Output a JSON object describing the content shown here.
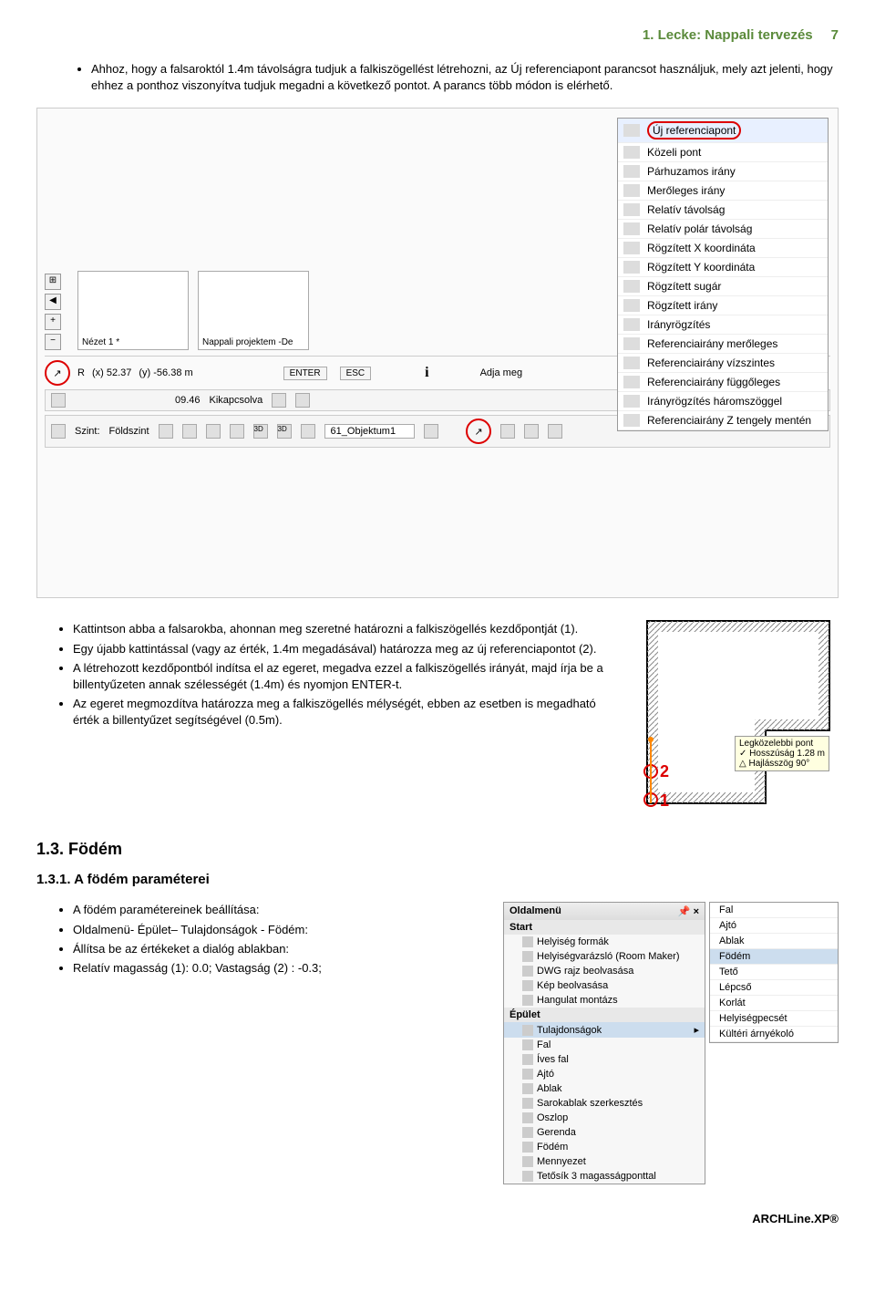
{
  "header": {
    "title": "1. Lecke: Nappali tervezés",
    "page": "7"
  },
  "intro": [
    "Ahhoz, hogy a falsaroktól 1.4m távolságra tudjuk a falkiszögellést létrehozni, az Új referenciapont parancsot használjuk, mely azt jelenti, hogy ehhez a ponthoz viszonyítva tudjuk megadni a következő pontot. A parancs több módon is elérhető."
  ],
  "ctx_items": [
    "Új referenciapont",
    "Közeli pont",
    "Párhuzamos irány",
    "Merőleges irány",
    "Relatív távolság",
    "Relatív polár távolság",
    "Rögzített X koordináta",
    "Rögzített Y koordináta",
    "Rögzített sugár",
    "Rögzített irány",
    "Irányrögzítés",
    "Referenciairány merőleges",
    "Referenciairány vízszintes",
    "Referenciairány függőleges",
    "Irányrögzítés háromszöggel",
    "Referenciairány Z tengely mentén"
  ],
  "thumbs": [
    "Nézet 1 *",
    "Nappali projektem -De"
  ],
  "status": {
    "x": "(x) 52.37",
    "y": "(y) -56.38 m",
    "enter": "ENTER",
    "esc": "ESC",
    "hint": "Adja meg"
  },
  "bar2": {
    "time": "09.46",
    "state": "Kikapcsolva"
  },
  "bar3": {
    "level_lbl": "Szint:",
    "level": "Földszint",
    "obj": "61_Objektum1"
  },
  "after_shot": [
    "Kattintson abba a falsarokba, ahonnan meg szeretné határozni a falkiszögellés kezdőpontját (1).",
    "Egy újabb kattintással (vagy az érték, 1.4m megadásával) határozza meg az új referenciapontot (2).",
    "A létrehozott kezdőpontból indítsa el az egeret, megadva ezzel a falkiszögellés irányát, majd írja be a billentyűzeten annak szélességét (1.4m) és nyomjon ENTER-t.",
    "Az egeret megmozdítva határozza meg a falkiszögellés mélységét, ebben az esetben is megadható érték a billentyűzet segítségével (0.5m)."
  ],
  "tooltip": {
    "t": "Legközelebbi pont",
    "l1": "Hosszúság",
    "v1": "1.28 m",
    "l2": "Hajlásszög",
    "v2": "90°"
  },
  "h2": "1.3. Födém",
  "h3": "1.3.1.  A födém paraméterei",
  "fodem_bullets": [
    "A födém paramétereinek beállítása:",
    "Oldalmenü- Épület– Tulajdonságok - Födém:",
    "Állítsa be az értékeket a dialóg ablakban:",
    "Relatív magasság (1): 0.0; Vastagság (2) : -0.3;"
  ],
  "panel": {
    "title": "Oldalmenü",
    "s1": "Start",
    "s1_items": [
      "Helyiség formák",
      "Helyiségvarázsló (Room Maker)",
      "DWG rajz beolvasása",
      "Kép beolvasása",
      "Hangulat montázs"
    ],
    "s2": "Épület",
    "s2_items": [
      "Tulajdonságok",
      "Fal",
      "Íves fal",
      "Ajtó",
      "Ablak",
      "Sarokablak szerkesztés",
      "Oszlop",
      "Gerenda",
      "Födém",
      "Mennyezet",
      "Tetősík 3 magasságponttal"
    ]
  },
  "subpanel": [
    "Fal",
    "Ajtó",
    "Ablak",
    "Födém",
    "Tető",
    "Lépcső",
    "Korlát",
    "Helyiségpecsét",
    "Kültéri árnyékoló"
  ],
  "footer": "ARCHLine.XP®"
}
